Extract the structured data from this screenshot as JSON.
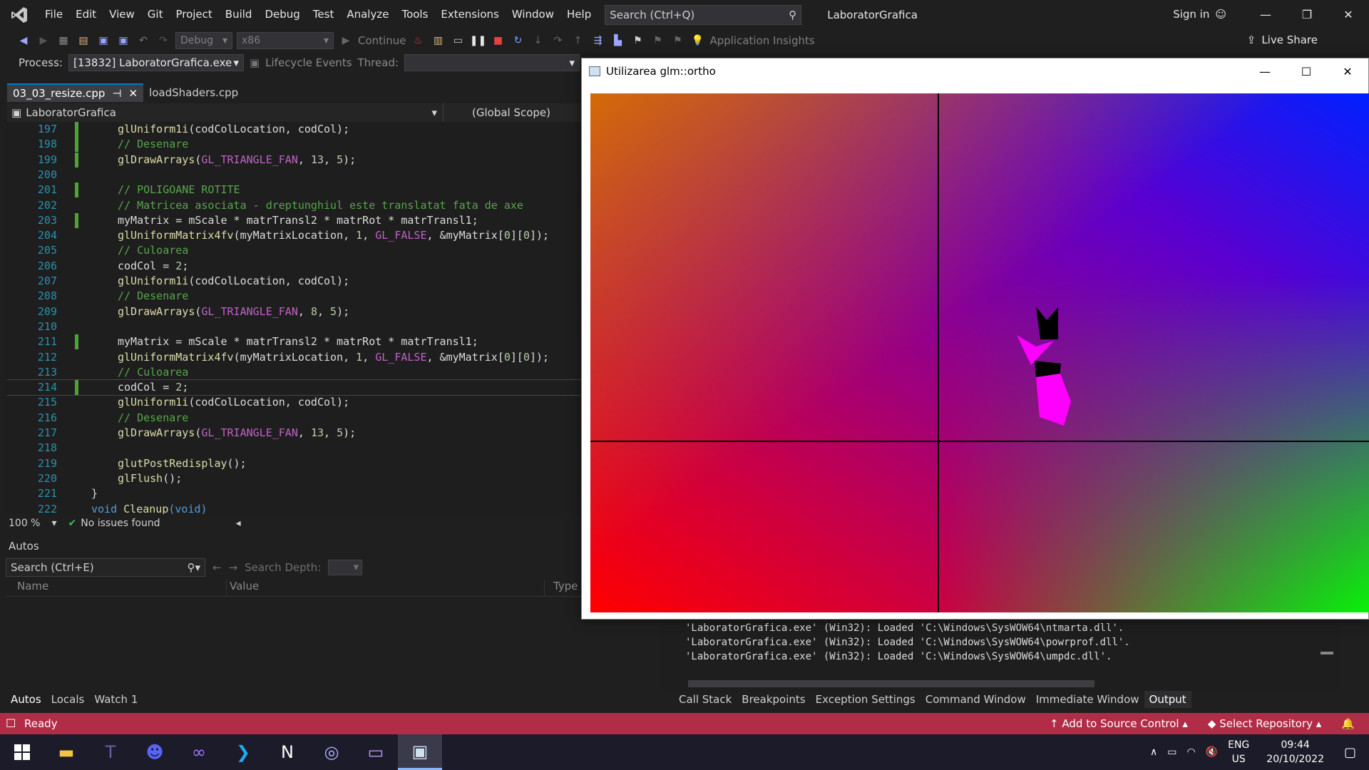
{
  "menubar": {
    "items": [
      "File",
      "Edit",
      "View",
      "Git",
      "Project",
      "Build",
      "Debug",
      "Test",
      "Analyze",
      "Tools",
      "Extensions",
      "Window",
      "Help"
    ],
    "search_placeholder": "Search (Ctrl+Q)",
    "title": "LaboratorGrafica",
    "sign_in": "Sign in"
  },
  "toolbar": {
    "config": "Debug",
    "platform": "x86",
    "continue": "Continue",
    "application_insights": "Application Insights",
    "live_share": "Live Share"
  },
  "processbar": {
    "label": "Process:",
    "process": "[13832] LaboratorGrafica.exe",
    "lifecycle": "Lifecycle Events",
    "thread_label": "Thread:"
  },
  "tabs": [
    {
      "label": "03_03_resize.cpp",
      "active": true
    },
    {
      "label": "loadShaders.cpp",
      "active": false
    }
  ],
  "navbar": {
    "project": "LaboratorGrafica",
    "scope": "(Global Scope)"
  },
  "code": [
    {
      "n": "197",
      "text": "glUniform1i(codColLocation, codCol);",
      "kind": "call",
      "changed": true
    },
    {
      "n": "198",
      "text": "// Desenare",
      "kind": "comment",
      "changed": true
    },
    {
      "n": "199",
      "text": "glDrawArrays(GL_TRIANGLE_FAN, 13, 5);",
      "kind": "call",
      "changed": true
    },
    {
      "n": "200",
      "text": "",
      "kind": "blank",
      "changed": false
    },
    {
      "n": "201",
      "text": "// POLIGOANE ROTITE",
      "kind": "comment",
      "changed": true
    },
    {
      "n": "202",
      "text": "// Matricea asociata - dreptunghiul este translatat fata de axe",
      "kind": "comment",
      "changed": false
    },
    {
      "n": "203",
      "text": "myMatrix = mScale * matrTransl2 * matrRot * matrTransl1;",
      "kind": "plain",
      "changed": true
    },
    {
      "n": "204",
      "text": "glUniformMatrix4fv(myMatrixLocation, 1, GL_FALSE, &myMatrix[0][0]);",
      "kind": "call",
      "changed": false
    },
    {
      "n": "205",
      "text": "// Culoarea",
      "kind": "comment",
      "changed": false
    },
    {
      "n": "206",
      "text": "codCol = 2;",
      "kind": "plain",
      "changed": false
    },
    {
      "n": "207",
      "text": "glUniform1i(codColLocation, codCol);",
      "kind": "call",
      "changed": false
    },
    {
      "n": "208",
      "text": "// Desenare",
      "kind": "comment",
      "changed": false
    },
    {
      "n": "209",
      "text": "glDrawArrays(GL_TRIANGLE_FAN, 8, 5);",
      "kind": "call",
      "changed": false
    },
    {
      "n": "210",
      "text": "",
      "kind": "blank",
      "changed": false
    },
    {
      "n": "211",
      "text": "myMatrix = mScale * matrTransl2 * matrRot * matrTransl1;",
      "kind": "plain",
      "changed": true
    },
    {
      "n": "212",
      "text": "glUniformMatrix4fv(myMatrixLocation, 1, GL_FALSE, &myMatrix[0][0]);",
      "kind": "call",
      "changed": false
    },
    {
      "n": "213",
      "text": "// Culoarea",
      "kind": "comment",
      "changed": false
    },
    {
      "n": "214",
      "text": "codCol = 2;",
      "kind": "plain",
      "changed": true
    },
    {
      "n": "215",
      "text": "glUniform1i(codColLocation, codCol);",
      "kind": "call",
      "changed": false
    },
    {
      "n": "216",
      "text": "// Desenare",
      "kind": "comment",
      "changed": false
    },
    {
      "n": "217",
      "text": "glDrawArrays(GL_TRIANGLE_FAN, 13, 5);",
      "kind": "call",
      "changed": false
    },
    {
      "n": "218",
      "text": "",
      "kind": "blank",
      "changed": false
    },
    {
      "n": "219",
      "text": "glutPostRedisplay();",
      "kind": "call",
      "changed": false
    },
    {
      "n": "220",
      "text": "glFlush();",
      "kind": "call",
      "changed": false
    },
    {
      "n": "221",
      "text": "}",
      "kind": "plain",
      "changed": false
    },
    {
      "n": "222",
      "text": "void Cleanup(void)",
      "kind": "decl",
      "changed": false
    }
  ],
  "editor_status": {
    "zoom": "100 %",
    "issues": "No issues found"
  },
  "autos": {
    "title": "Autos",
    "search_placeholder": "Search (Ctrl+E)",
    "search_depth": "Search Depth:",
    "columns": [
      "Name",
      "Value",
      "Type"
    ],
    "tabs": [
      "Autos",
      "Locals",
      "Watch 1"
    ]
  },
  "output": {
    "lines": [
      "'LaboratorGrafica.exe' (Win32): Loaded 'C:\\Windows\\SysWOW64\\ntmarta.dll'.",
      "'LaboratorGrafica.exe' (Win32): Loaded 'C:\\Windows\\SysWOW64\\powrprof.dll'.",
      "'LaboratorGrafica.exe' (Win32): Loaded 'C:\\Windows\\SysWOW64\\umpdc.dll'."
    ],
    "tabs": [
      "Call Stack",
      "Breakpoints",
      "Exception Settings",
      "Command Window",
      "Immediate Window",
      "Output"
    ]
  },
  "statusbar": {
    "ready": "Ready",
    "add_source": "Add to Source Control",
    "select_repo": "Select Repository",
    "color": "#b12d47"
  },
  "taskbar": {
    "apps": [
      "windows-start",
      "file-explorer",
      "teams",
      "discord",
      "visual-studio",
      "vs-code",
      "notion",
      "chrome",
      "terminal",
      "glut-window"
    ],
    "lang1": "ENG",
    "lang2": "US",
    "time": "09:44",
    "date": "20/10/2022"
  },
  "gl_window": {
    "title": "Utilizarea glm::ortho"
  }
}
